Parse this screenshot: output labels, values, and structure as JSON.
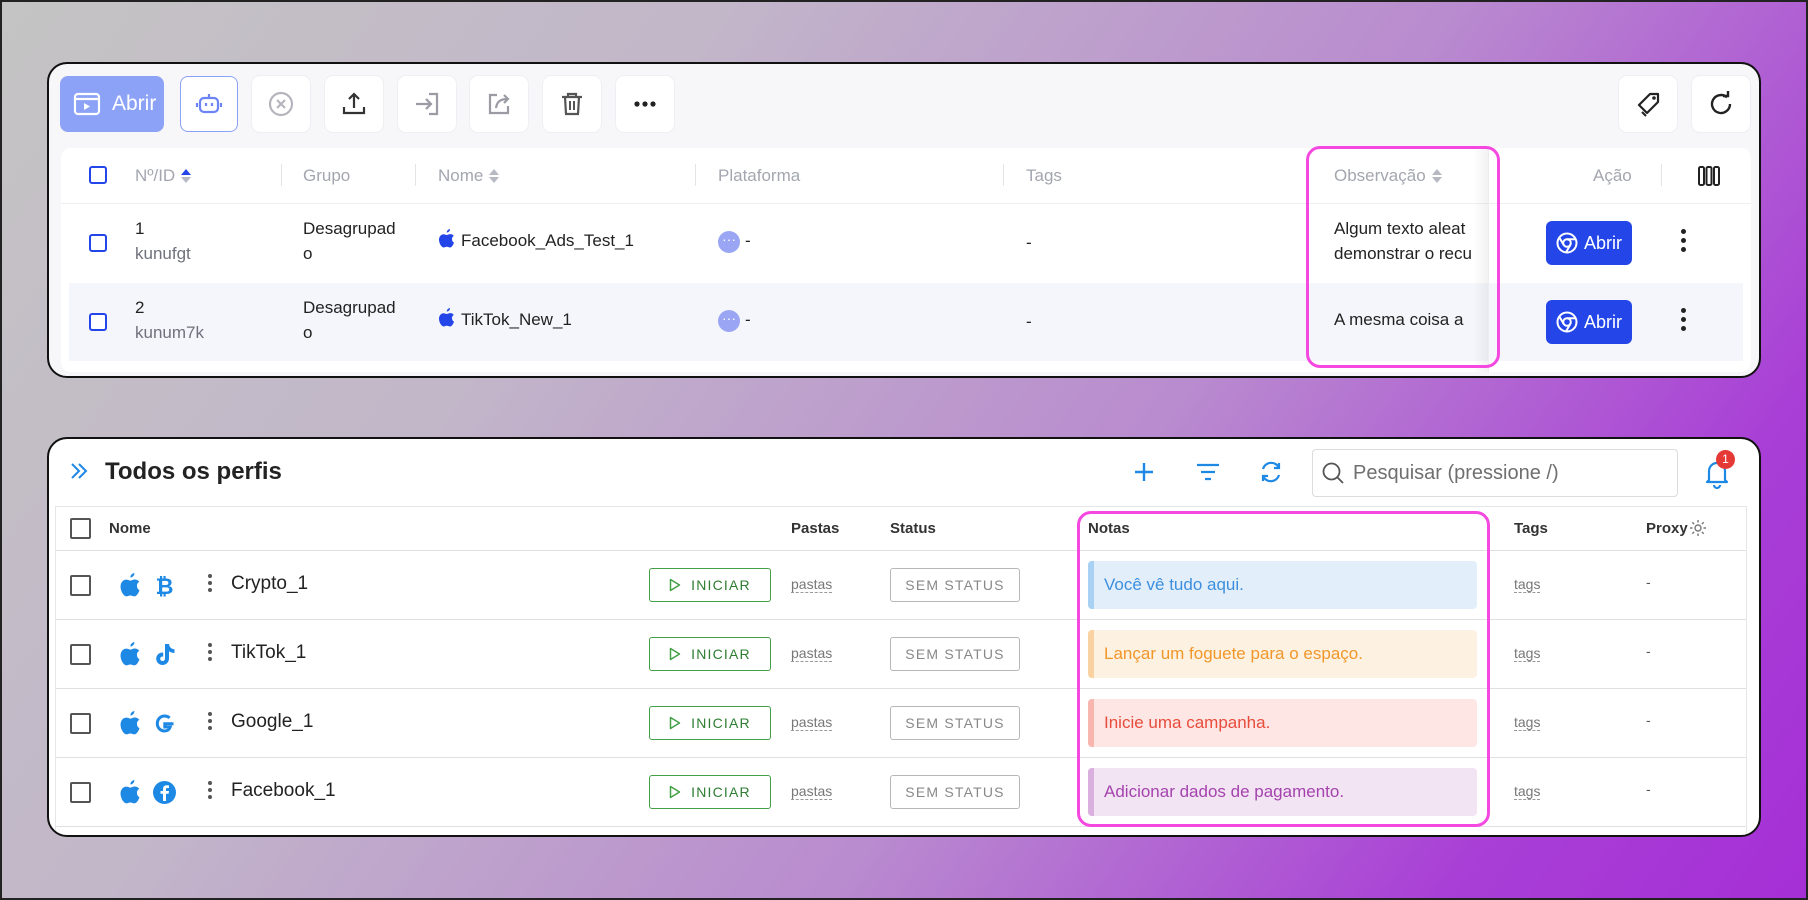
{
  "top_panel": {
    "toolbar": {
      "open_label": "Abrir",
      "buttons": [
        "robot-icon",
        "close-circle-icon",
        "upload-icon",
        "import-icon",
        "share-icon",
        "trash-icon",
        "more-icon",
        "tag-icon",
        "refresh-icon"
      ]
    },
    "columns": {
      "id": "Nº/ID",
      "group": "Grupo",
      "name": "Nome",
      "platform": "Plataforma",
      "tags": "Tags",
      "note": "Observação",
      "action": "Ação"
    },
    "rows": [
      {
        "num": "1",
        "id": "kunufgt",
        "group_line1": "Desagrupad",
        "group_line2": "o",
        "name": "Facebook_Ads_Test_1",
        "platform": "-",
        "tags": "-",
        "note_line1": "Algum texto aleat",
        "note_line2": "demonstrar o recu",
        "action": "Abrir"
      },
      {
        "num": "2",
        "id": "kunum7k",
        "group_line1": "Desagrupad",
        "group_line2": "o",
        "name": "TikTok_New_1",
        "platform": "-",
        "tags": "-",
        "note_line1": "A mesma coisa a",
        "note_line2": "",
        "action": "Abrir"
      }
    ]
  },
  "bottom_panel": {
    "title": "Todos os perfis",
    "search_placeholder": "Pesquisar (pressione /)",
    "notification_count": "1",
    "columns": {
      "name": "Nome",
      "folders": "Pastas",
      "status": "Status",
      "notes": "Notas",
      "tags": "Tags",
      "proxy": "Proxy"
    },
    "rows": [
      {
        "platform_icon": "bitcoin-icon",
        "name": "Crypto_1",
        "start": "INICIAR",
        "folders": "pastas",
        "status": "SEM STATUS",
        "note": "Você vê tudo aqui.",
        "note_color": "#3d8fdd",
        "tags": "tags",
        "proxy": "-"
      },
      {
        "platform_icon": "tiktok-icon",
        "name": "TikTok_1",
        "start": "INICIAR",
        "folders": "pastas",
        "status": "SEM STATUS",
        "note": "Lançar um foguete para o espaço.",
        "note_color": "#f1972a",
        "tags": "tags",
        "proxy": "-"
      },
      {
        "platform_icon": "google-icon",
        "name": "Google_1",
        "start": "INICIAR",
        "folders": "pastas",
        "status": "SEM STATUS",
        "note": "Inicie uma campanha.",
        "note_color": "#e74c3c",
        "tags": "tags",
        "proxy": "-"
      },
      {
        "platform_icon": "facebook-icon",
        "name": "Facebook_1",
        "start": "INICIAR",
        "folders": "pastas",
        "status": "SEM STATUS",
        "note": "Adicionar dados de pagamento.",
        "note_color": "#a443ae",
        "tags": "tags",
        "proxy": "-"
      }
    ]
  },
  "colors": {
    "primary_blue": "#2446e8",
    "highlight_pink": "#f548e0",
    "start_green": "#43a047"
  }
}
